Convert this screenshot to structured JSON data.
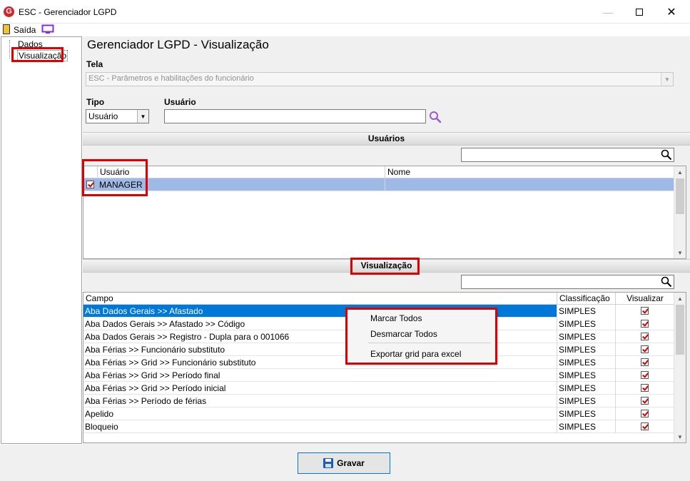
{
  "window": {
    "title": "ESC - Gerenciador LGPD",
    "logo_letter": "G",
    "controls": [
      "minimize",
      "maximize",
      "close"
    ]
  },
  "toolbar": {
    "exit_label": "Saída",
    "exit_icon": "door-exit-icon",
    "monitor_icon": "monitor-icon"
  },
  "tree": {
    "items": [
      {
        "label": "Dados",
        "selected": false
      },
      {
        "label": "Visualização",
        "selected": true
      }
    ]
  },
  "main": {
    "page_title": "Gerenciador LGPD - Visualização",
    "tela_label": "Tela",
    "tela_value": "ESC - Parâmetros e habilitações do funcionário",
    "tipo_label": "Tipo",
    "tipo_value": "Usuário",
    "usuario_label": "Usuário",
    "usuario_value": ""
  },
  "usuarios_section": {
    "header": "Usuários",
    "search_value": "",
    "columns": [
      "Usuário",
      "Nome"
    ],
    "rows": [
      {
        "checked": true,
        "usuario": "MANAGER",
        "nome": "",
        "selected": true
      }
    ]
  },
  "visualizacao_section": {
    "header": "Visualização",
    "search_value": "",
    "columns": [
      "Campo",
      "Classificação",
      "Visualizar"
    ],
    "rows": [
      {
        "campo": "Aba Dados Gerais >> Afastado",
        "classificacao": "SIMPLES",
        "visualizar": true,
        "selected": true
      },
      {
        "campo": "Aba Dados Gerais >> Afastado >> Código",
        "classificacao": "SIMPLES",
        "visualizar": true,
        "selected": false
      },
      {
        "campo": "Aba Dados Gerais >> Registro - Dupla para o 001066",
        "classificacao": "SIMPLES",
        "visualizar": true,
        "selected": false
      },
      {
        "campo": "Aba Férias >> Funcionário substituto",
        "classificacao": "SIMPLES",
        "visualizar": true,
        "selected": false
      },
      {
        "campo": "Aba Férias >> Grid >> Funcionário substituto",
        "classificacao": "SIMPLES",
        "visualizar": true,
        "selected": false
      },
      {
        "campo": "Aba Férias >> Grid >> Período final",
        "classificacao": "SIMPLES",
        "visualizar": true,
        "selected": false
      },
      {
        "campo": "Aba Férias >> Grid >> Período inicial",
        "classificacao": "SIMPLES",
        "visualizar": true,
        "selected": false
      },
      {
        "campo": "Aba Férias >> Período de férias",
        "classificacao": "SIMPLES",
        "visualizar": true,
        "selected": false
      },
      {
        "campo": "Apelido",
        "classificacao": "SIMPLES",
        "visualizar": true,
        "selected": false
      },
      {
        "campo": "Bloqueio",
        "classificacao": "SIMPLES",
        "visualizar": true,
        "selected": false
      }
    ]
  },
  "context_menu": {
    "items": [
      "Marcar Todos",
      "Desmarcar Todos",
      "Exportar grid para excel"
    ]
  },
  "footer": {
    "save_label": "Gravar"
  },
  "colors": {
    "selection_blue": "#0078d7",
    "row_highlight": "#9fb9e6",
    "annotation_red": "#e00000"
  }
}
